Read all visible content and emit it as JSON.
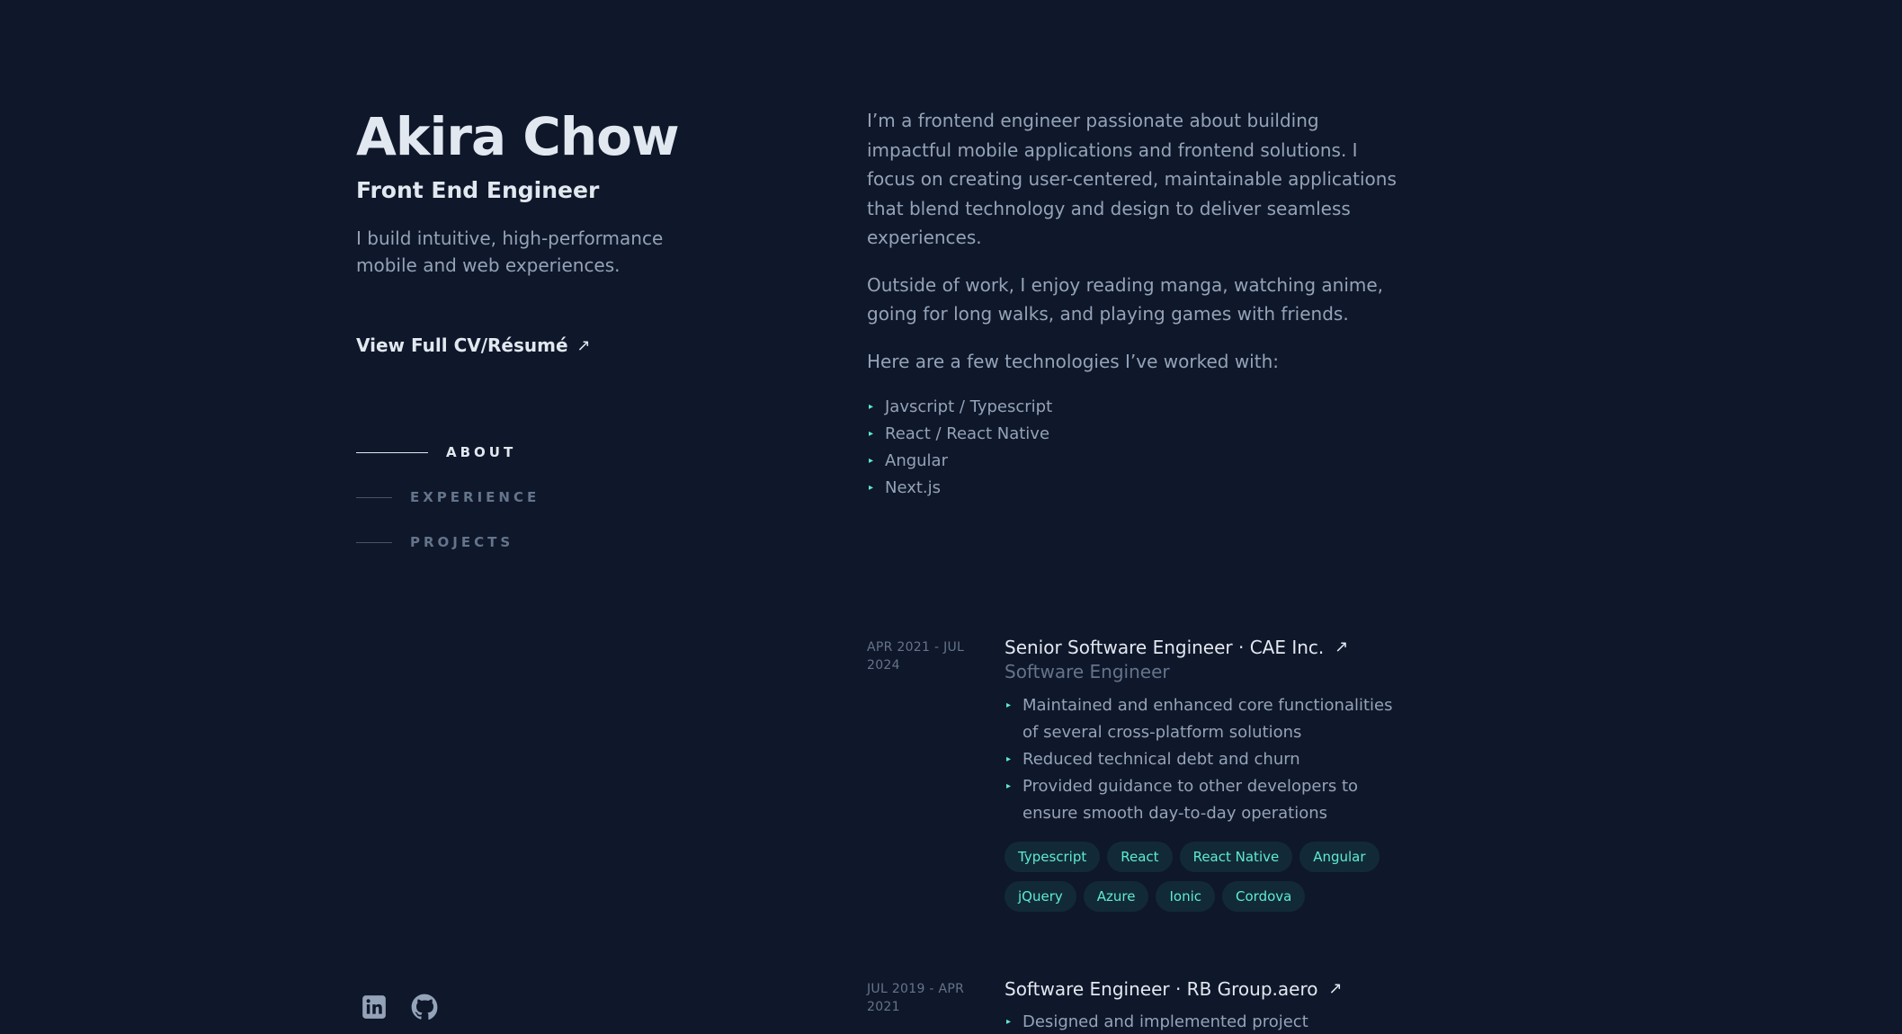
{
  "profile": {
    "name": "Akira Chow",
    "role": "Front End Engineer",
    "tagline": "I build intuitive, high-performance mobile and web experiences.",
    "cv_link": "View Full CV/Résumé",
    "cv_arrow": "↗"
  },
  "nav": {
    "items": [
      {
        "label": "ABOUT"
      },
      {
        "label": "EXPERIENCE"
      },
      {
        "label": "PROJECTS"
      }
    ]
  },
  "about": {
    "paragraphs": [
      "I’m a frontend engineer passionate about building impactful mobile applications and frontend solutions. I focus on creating user-centered, maintainable applications that blend technology and design to deliver seamless experiences.",
      "Outside of work, I enjoy reading manga, watching anime, going for long walks, and playing games with friends.",
      "Here are a few technologies I’ve worked with:"
    ],
    "technologies": [
      "Javscript / Typescript",
      "React / React Native",
      "Angular",
      "Next.js"
    ],
    "bullet_icon": "▸"
  },
  "experience": [
    {
      "date": "APR 2021 - JUL 2024",
      "title": "Senior Software Engineer · CAE Inc.",
      "arrow": "↗",
      "subtitle": "Software Engineer",
      "bullets": [
        "Maintained and enhanced core functionalities of several cross-platform solutions",
        "Reduced technical debt and churn",
        "Provided guidance to other developers to ensure smooth day-to-day operations"
      ],
      "tags": [
        "Typescript",
        "React",
        "React Native",
        "Angular",
        "jQuery",
        "Azure",
        "Ionic",
        "Cordova"
      ]
    },
    {
      "date": "JUL 2019 - APR 2021",
      "title": "Software Engineer · RB Group.aero",
      "arrow": "↗",
      "bullets": [
        "Designed and implemented project architectures"
      ]
    }
  ],
  "socials": {
    "linkedin_icon": "linkedin-icon",
    "github_icon": "github-icon"
  },
  "colors": {
    "background": "#0f172a",
    "text_primary": "#e2e8f0",
    "text_secondary": "#94a3b8",
    "accent": "#5eead4"
  }
}
